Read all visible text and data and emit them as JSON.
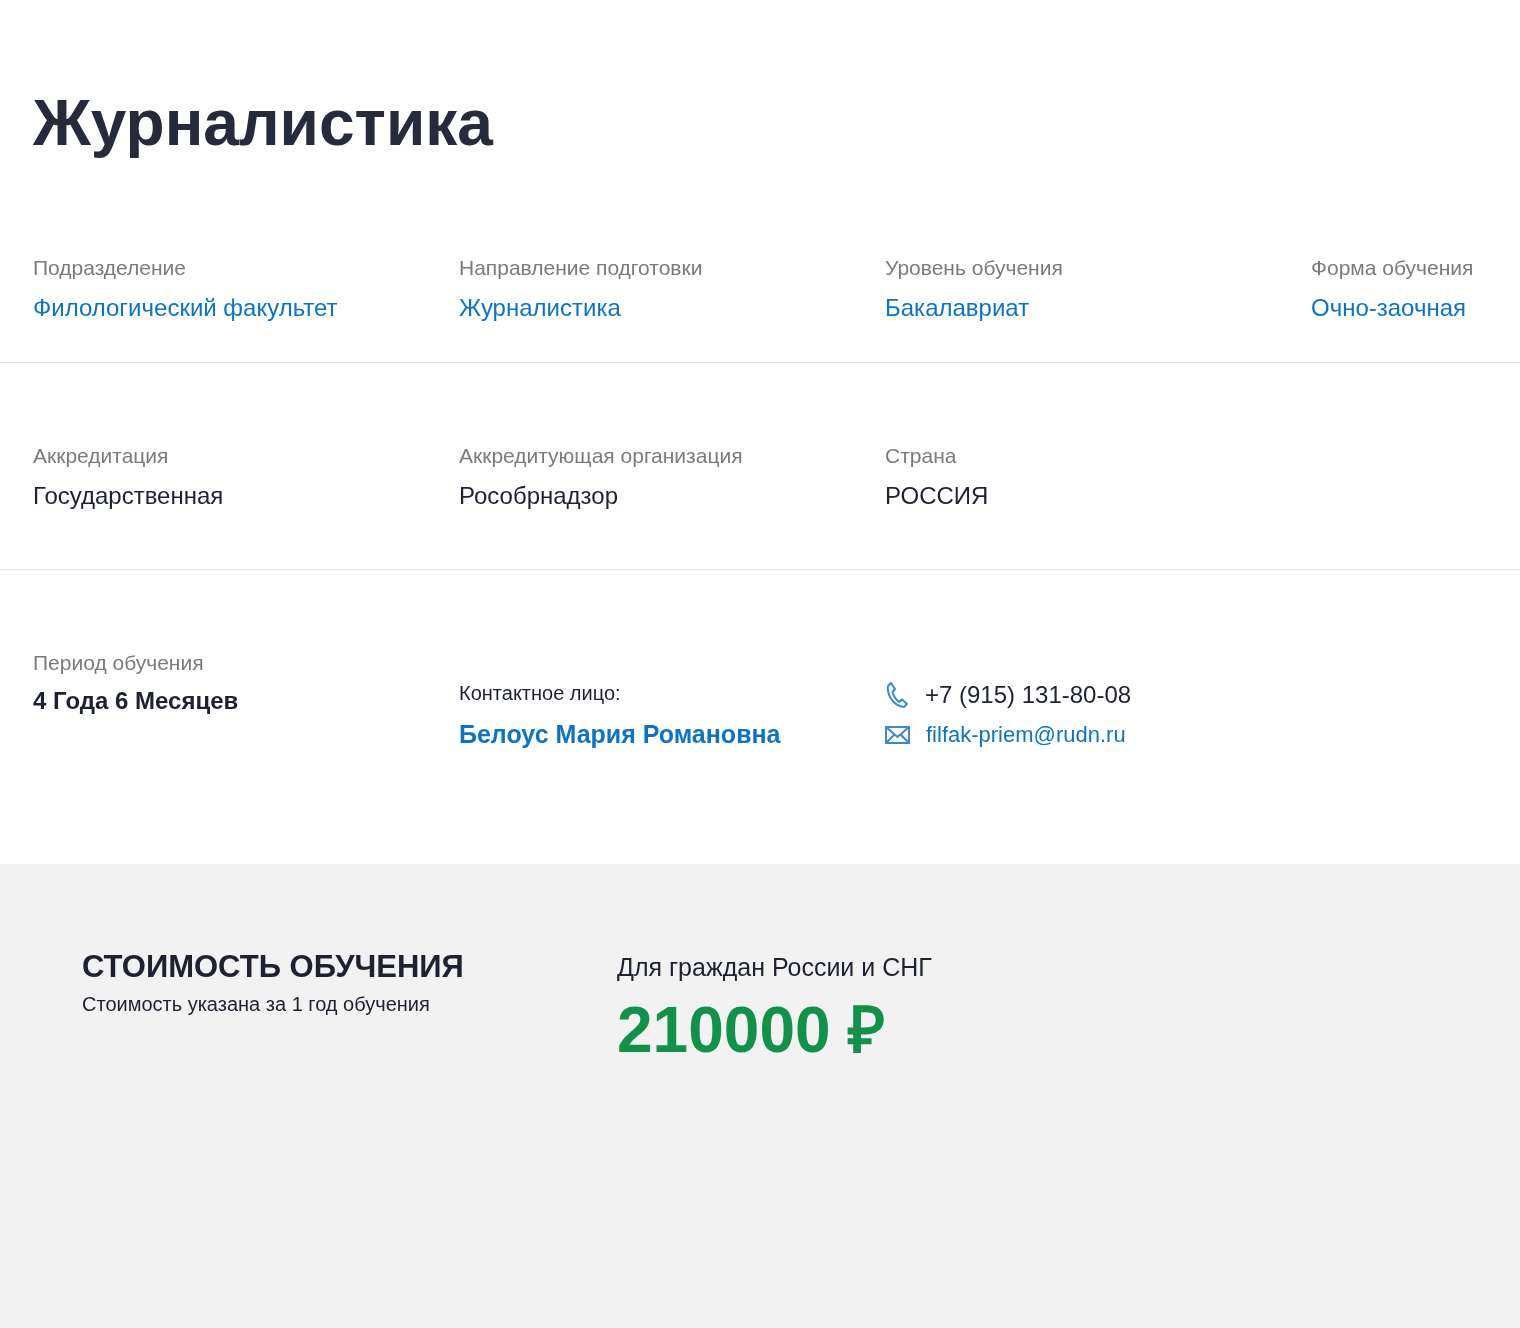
{
  "title": "Журналистика",
  "detail_rows": [
    {
      "items": [
        {
          "label": "Подразделение",
          "value": "Филологический факультет",
          "link": true
        },
        {
          "label": "Направление подготовки",
          "value": "Журналистика",
          "link": true
        },
        {
          "label": "Уровень обучения",
          "value": "Бакалавриат",
          "link": true
        },
        {
          "label": "Форма обучения",
          "value": "Очно-заочная",
          "link": true
        }
      ]
    },
    {
      "items": [
        {
          "label": "Аккредитация",
          "value": "Государственная",
          "link": false
        },
        {
          "label": "Аккредитующая организация",
          "value": "Рособрнадзор",
          "link": false
        },
        {
          "label": "Страна",
          "value": "РОССИЯ",
          "link": false
        }
      ]
    }
  ],
  "period": {
    "label": "Период обучения",
    "value": "4 Года 6 Месяцев"
  },
  "contact": {
    "label": "Контактное лицо:",
    "name": "Белоус Мария Романовна",
    "phone": "+7 (915) 131-80-08",
    "email": "filfak-priem@rudn.ru"
  },
  "pricing": {
    "title": "СТОИМОСТЬ ОБУЧЕНИЯ",
    "note": "Стоимость указана за 1 год обучения",
    "audience": "Для граждан России и СНГ",
    "price": "210000 ₽"
  }
}
